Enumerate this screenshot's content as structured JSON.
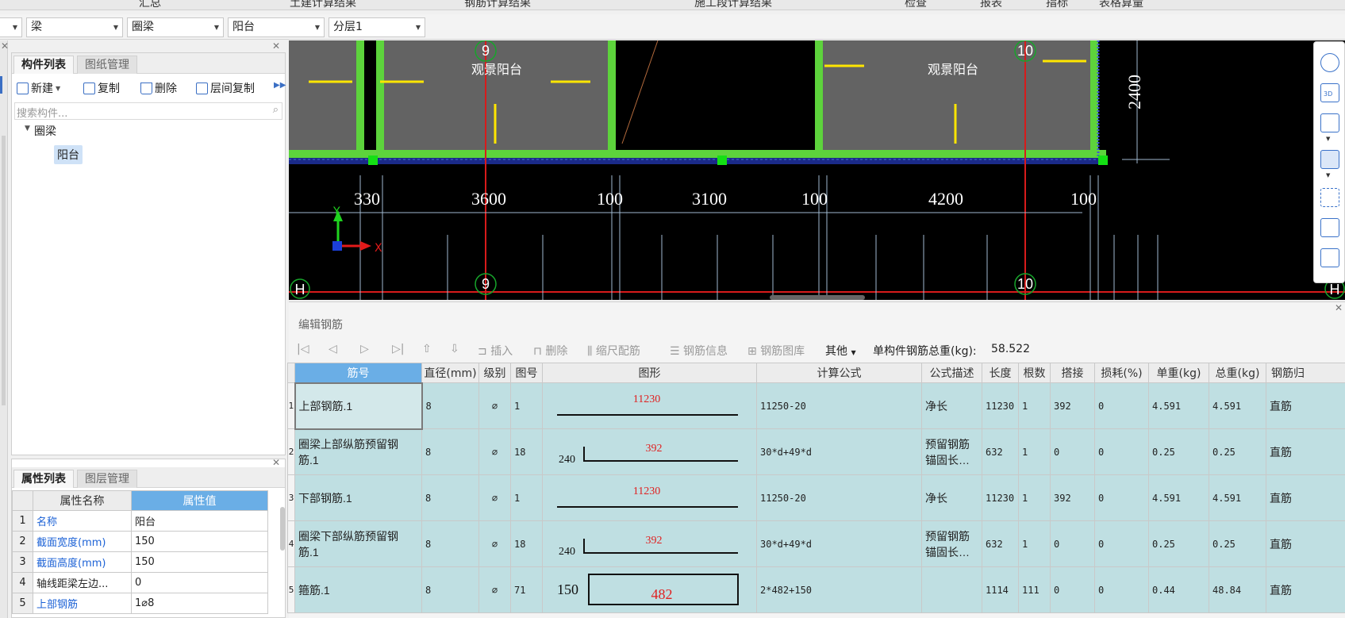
{
  "top_menu": [
    "汇总",
    "土建计算结果",
    "钢筋计算结果",
    "施工段计算结果",
    "检查",
    "报表",
    "指标",
    "表格算量"
  ],
  "dropdowns": [
    {
      "value": ""
    },
    {
      "value": "梁"
    },
    {
      "value": "圈梁"
    },
    {
      "value": "阳台"
    },
    {
      "value": "分层1"
    }
  ],
  "component_panel": {
    "tabs": [
      "构件列表",
      "图纸管理"
    ],
    "toolbar": {
      "new": "新建",
      "copy": "复制",
      "delete": "删除",
      "floor_copy": "层间复制"
    },
    "search_placeholder": "搜索构件...",
    "tree": {
      "group": "圈梁",
      "item": "阳台"
    }
  },
  "property_panel": {
    "tabs": [
      "属性列表",
      "图层管理"
    ],
    "headers": [
      "属性名称",
      "属性值"
    ],
    "rows": [
      {
        "n": "1",
        "name": "名称",
        "value": "阳台",
        "blue": true
      },
      {
        "n": "2",
        "name": "截面宽度(mm)",
        "value": "150",
        "blue": true
      },
      {
        "n": "3",
        "name": "截面高度(mm)",
        "value": "150",
        "blue": true
      },
      {
        "n": "4",
        "name": "轴线距梁左边...",
        "value": "0",
        "blue": false
      },
      {
        "n": "5",
        "name": "上部钢筋",
        "value": "1⌀8",
        "blue": true
      }
    ]
  },
  "cad": {
    "axis_labels": [
      "9",
      "10",
      "9",
      "10",
      "H",
      "H"
    ],
    "dims": [
      "330",
      "3600",
      "100",
      "3100",
      "100",
      "4200",
      "100"
    ],
    "vertical_dim": "2400",
    "room_labels": [
      "观景阳台",
      "观景阳台"
    ],
    "axes": {
      "x": "X",
      "y": "Y"
    }
  },
  "rebar_editor": {
    "title": "编辑钢筋",
    "toolbar": {
      "insert": "插入",
      "delete": "删除",
      "scale": "缩尺配筋",
      "info": "钢筋信息",
      "library": "钢筋图库",
      "other": "其他",
      "total_label": "单构件钢筋总重(kg):",
      "total_value": "58.522"
    },
    "headers": [
      "筋号",
      "直径(mm)",
      "级别",
      "图号",
      "图形",
      "计算公式",
      "公式描述",
      "长度",
      "根数",
      "搭接",
      "损耗(%)",
      "单重(kg)",
      "总重(kg)",
      "钢筋归"
    ],
    "rows": [
      {
        "no": "1",
        "name": "上部钢筋.1",
        "dia": "8",
        "grade": "⌀",
        "fig": "1",
        "shape_left": "",
        "shape_val": "11230",
        "formula": "11250-20",
        "desc": "净长",
        "len": "11230",
        "count": "1",
        "lap": "392",
        "loss": "0",
        "unit_w": "4.591",
        "total_w": "4.591",
        "type": "直筋"
      },
      {
        "no": "2",
        "name": "圈梁上部纵筋预留钢筋.1",
        "dia": "8",
        "grade": "⌀",
        "fig": "18",
        "shape_left": "240",
        "shape_val": "392",
        "formula": "30*d+49*d",
        "desc": "预留钢筋锚固长…",
        "len": "632",
        "count": "1",
        "lap": "0",
        "loss": "0",
        "unit_w": "0.25",
        "total_w": "0.25",
        "type": "直筋"
      },
      {
        "no": "3",
        "name": "下部钢筋.1",
        "dia": "8",
        "grade": "⌀",
        "fig": "1",
        "shape_left": "",
        "shape_val": "11230",
        "formula": "11250-20",
        "desc": "净长",
        "len": "11230",
        "count": "1",
        "lap": "392",
        "loss": "0",
        "unit_w": "4.591",
        "total_w": "4.591",
        "type": "直筋"
      },
      {
        "no": "4",
        "name": "圈梁下部纵筋预留钢筋.1",
        "dia": "8",
        "grade": "⌀",
        "fig": "18",
        "shape_left": "240",
        "shape_val": "392",
        "formula": "30*d+49*d",
        "desc": "预留钢筋锚固长…",
        "len": "632",
        "count": "1",
        "lap": "0",
        "loss": "0",
        "unit_w": "0.25",
        "total_w": "0.25",
        "type": "直筋"
      },
      {
        "no": "5",
        "name": "箍筋.1",
        "dia": "8",
        "grade": "⌀",
        "fig": "71",
        "shape_left": "150",
        "shape_val": "482",
        "formula": "2*482+150",
        "desc": "",
        "len": "1114",
        "count": "111",
        "lap": "0",
        "loss": "0",
        "unit_w": "0.44",
        "total_w": "48.84",
        "type": "直筋"
      }
    ]
  }
}
